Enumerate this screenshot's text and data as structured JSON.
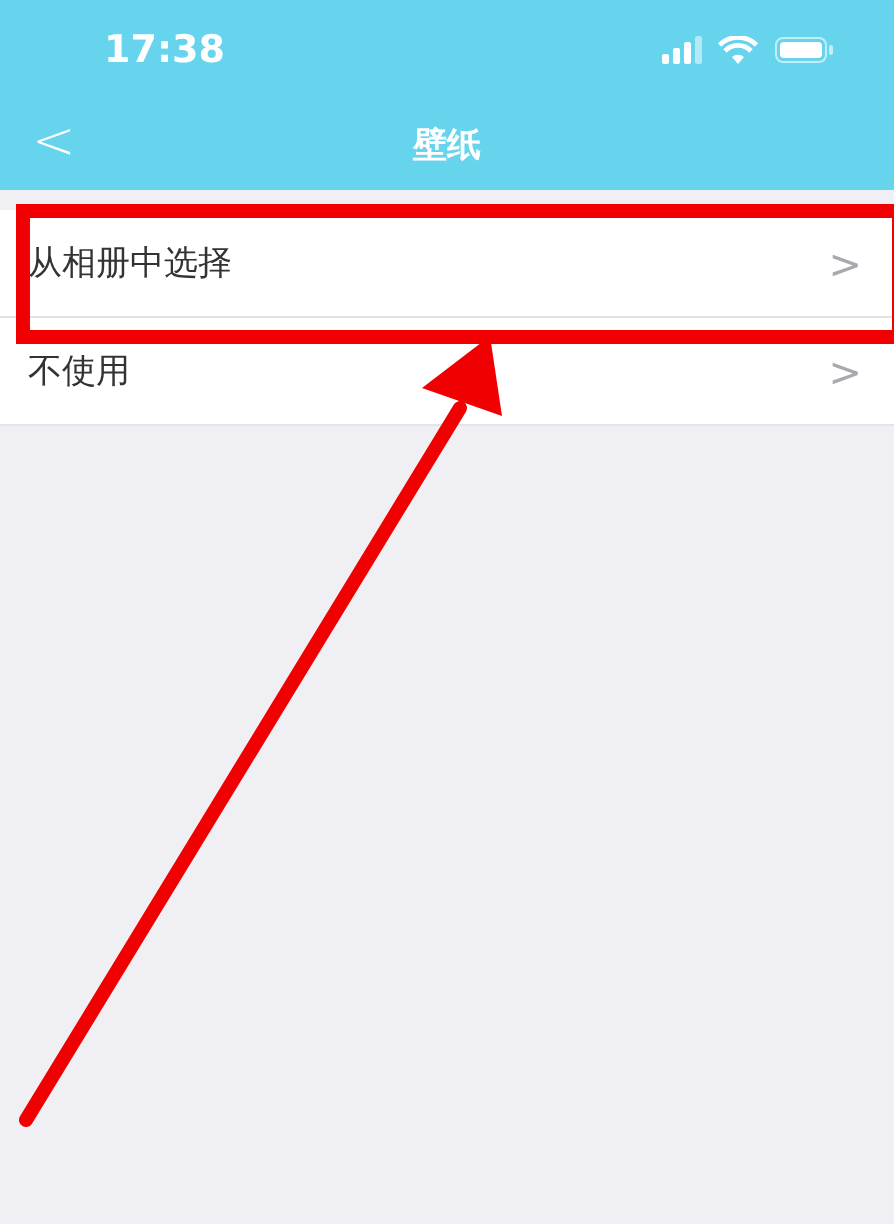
{
  "status_bar": {
    "time": "17:38"
  },
  "nav_bar": {
    "back": "<",
    "title": "壁纸"
  },
  "items": [
    {
      "label": "从相册中选择",
      "chevron": ">",
      "highlighted": true
    },
    {
      "label": "不使用",
      "chevron": ">",
      "highlighted": false
    }
  ]
}
